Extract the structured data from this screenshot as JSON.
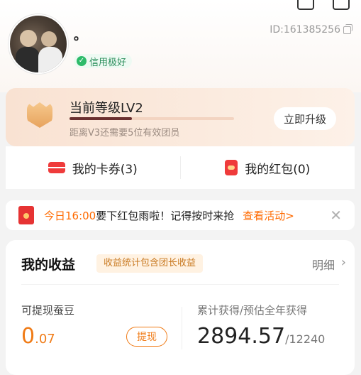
{
  "profile": {
    "nickname": "。",
    "credit_label": "信用极好",
    "user_id": "ID:161385256"
  },
  "level": {
    "title": "当前等级LV2",
    "progress_fraction": 0.38,
    "subtitle": "距离V3还需要5位有效团员",
    "upgrade_label": "立即升级"
  },
  "wallet": {
    "coupons_label": "我的卡券(3)",
    "redpack_label": "我的红包(0)"
  },
  "notice": {
    "time": "今日16:00",
    "text": "要下红包雨啦！记得按时来抢",
    "link": "查看活动>",
    "close": "✕"
  },
  "earnings": {
    "title": "我的收益",
    "tag": "收益统计包含团长收益",
    "detail_label": "明细",
    "detail_chevron": "›",
    "withdrawable_label": "可提现蚕豆",
    "withdrawable_int": "0",
    "withdrawable_dec": ".07",
    "withdraw_button": "提现",
    "total_label": "累计获得/预估全年获得",
    "total_value": "2894.57",
    "total_estimate": "/12240"
  },
  "colors": {
    "accent": "#ff6a00",
    "level_card": "#f9e2d2",
    "credit_green": "#2dbb6a",
    "red": "#ef3b3b"
  }
}
